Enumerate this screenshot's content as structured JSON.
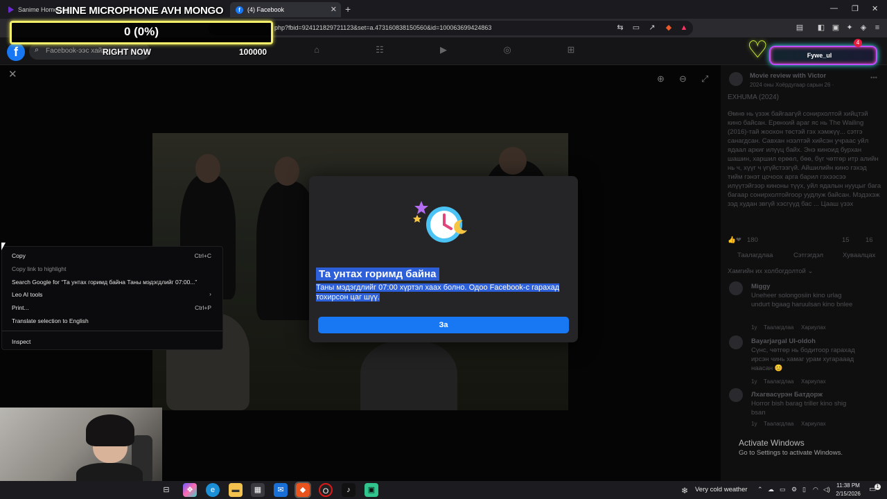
{
  "browser": {
    "tabs": [
      {
        "label": "Sanime Homepage"
      },
      {
        "label": "(4) Facebook"
      }
    ],
    "new_tab": "+",
    "address": "php?fbid=924121829721123&set=a.473160838150560&id=100063699424863",
    "window_controls": {
      "minimize": "—",
      "maximize": "❐",
      "close": "✕"
    }
  },
  "stream_overlay": {
    "title": "SHINE MICROPHONE AVH MONGO",
    "percent": "0 (0%)",
    "progress_fraction": 0,
    "right_now": "RIGHT NOW",
    "goal": "100000",
    "viewer_name": "Fywe_ul",
    "notification_count": "4"
  },
  "facebook": {
    "logo": "f",
    "search_placeholder": "Facebook-ээс хайх",
    "nav_icons": [
      "home-icon",
      "friends-icon",
      "watch-icon",
      "groups-icon",
      "gaming-icon"
    ],
    "post": {
      "page_name": "Movie review with Victor",
      "date": "2024 оны Хоёрдугаар сарын 26 · ",
      "heading": "EXHUMA (2024)",
      "body": "Өмнө нь үзэж байгаагүй сонирхолтой хийцтэй кино байсан. Ерөнхий араг яс нь The Wailing (2016)-тай жоохон төстэй гэх хэмжүү... сэтгэ санагдсан. Савхан нзэлтэй хийсэн учраас уйл ядаал аркиг илүүц байх. Энэ киноид бурхан шашин, харшил ерөөл, бөө, бүг чөтгөр итр алийн нь ч, хүүг ч үгүйстэзгүй. Айшилийн кино гэхэд тийм гэнэт цочоох арга барил гэхээсээ илүүтэйгээр киноны түүх, уйл ядалын нууцыг бага багаар сонирхолтойгоор уудлуж байсан. Мэдэхэж зэд худан звгүй хэсгүүд бас ... Цааш үзэх",
      "reactions": "180",
      "comment_count": "15",
      "share_count": "16",
      "actions": [
        "Таалагдлаа",
        "Сэтгэгдэл",
        "Хуваалцах"
      ],
      "comments_filter": "Хамгийн их холбогдолтой ⌄"
    },
    "comments": [
      {
        "author": "Miggy",
        "text": "Uneheer solongosiin kino urlag undurt bgaag haruulsan kino bnlee",
        "time": "1y",
        "like": "Таалагдлаа",
        "reply": "Хариулах"
      },
      {
        "author": "Bayarjargal Ul-oldoh",
        "text": "Сүнс, чөтгөр нь бодитоор гарахад ирсэн чинь хамаг урам хугарааад наасан 😊",
        "time": "1y",
        "like": "Таалагдлаа",
        "reply": "Хариулах"
      },
      {
        "author": "Лхагвасүрэн Батдорж",
        "text": "Horror bish barag triller kino shig bsan",
        "time": "1y",
        "like": "Таалагдлаа",
        "reply": "Хариулах"
      }
    ]
  },
  "dialog": {
    "title": "Та унтах горимд байна",
    "body": "Таны мэдэгдлийг 07:00 хүртэл хаах болно. Одоо Facebook-с гарахад тохирсон цаг шүү.",
    "button": "За"
  },
  "context_menu": {
    "items": [
      {
        "label": "Copy",
        "shortcut": "Ctrl+C"
      },
      {
        "label": "Copy link to highlight",
        "shortcut": ""
      },
      {
        "label": "Search Google for “Та унтах горимд байна Таны мэдэгдлийг 07:00...”",
        "shortcut": ""
      },
      {
        "label": "Leo AI tools",
        "shortcut": "›"
      },
      {
        "label": "Print...",
        "shortcut": "Ctrl+P"
      },
      {
        "label": "Translate selection to English",
        "shortcut": ""
      },
      {
        "label": "Inspect",
        "shortcut": ""
      }
    ]
  },
  "activate_windows": {
    "title": "Activate Windows",
    "subtitle": "Go to Settings to activate Windows."
  },
  "taskbar": {
    "weather": "Very cold weather",
    "time": "11:38 PM",
    "date": "2/15/2026",
    "notifications": "1"
  },
  "colors": {
    "facebook_blue": "#1877f2",
    "selection": "#2c5fd8",
    "overlay_border": "#f4ef6a"
  }
}
